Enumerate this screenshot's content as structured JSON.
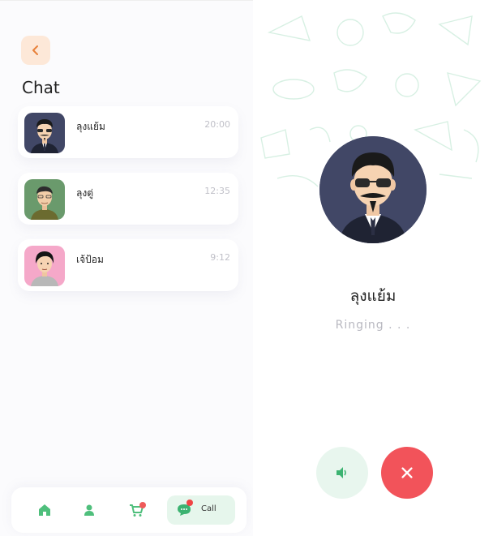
{
  "header": {
    "title": "Chat"
  },
  "chats": [
    {
      "name": "ลุงแย้ม",
      "time": "20:00"
    },
    {
      "name": "ลุงตู่",
      "time": "12:35"
    },
    {
      "name": "เจ้ป้อม",
      "time": "9:12"
    }
  ],
  "nav": {
    "items": [
      {
        "icon": "home-icon"
      },
      {
        "icon": "user-icon"
      },
      {
        "icon": "cart-icon"
      },
      {
        "icon": "chat-icon",
        "label": "Call"
      }
    ],
    "call_label": "Call"
  },
  "call": {
    "caller_name": "ลุงแย้ม",
    "status": "Ringing . . ."
  },
  "colors": {
    "accent_orange": "#e8813a",
    "accent_green": "#3cb371",
    "hangup_red": "#f2535a",
    "badge_red": "#ef4444"
  }
}
